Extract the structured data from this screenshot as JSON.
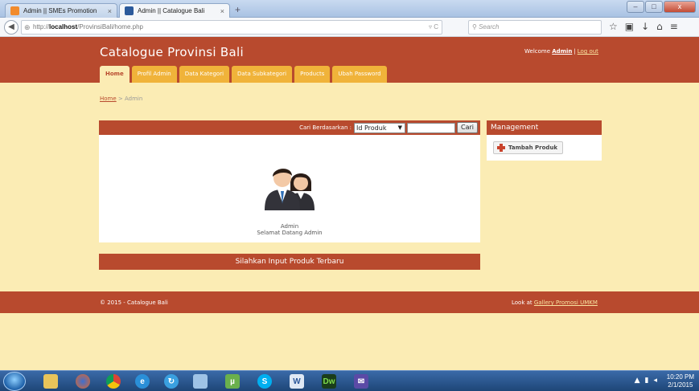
{
  "browser": {
    "tabs": [
      {
        "label": "Admin || SMEs Promotion",
        "active": false
      },
      {
        "label": "Admin || Catalogue Bali",
        "active": true
      }
    ],
    "new_tab": "+",
    "url_prefix": "http://",
    "url_host": "localhost",
    "url_path": "/ProvinsiBali/home.php",
    "search_placeholder": "Search",
    "window_buttons": [
      "–",
      "□",
      "x"
    ]
  },
  "site": {
    "title": "Catalogue Provinsi Bali",
    "welcome_prefix": "Welcome",
    "user": "Admin",
    "separator": "|",
    "logout": "Log out",
    "nav": [
      "Home",
      "Profil Admin",
      "Data Kategori",
      "Data Subkategori",
      "Products",
      "Ubah Password"
    ],
    "active_nav": "Home",
    "breadcrumb": {
      "home": "Home",
      "sep": " > ",
      "current": "Admin"
    },
    "search": {
      "label": "Cari Berdasarkan :",
      "selected": "Id Produk",
      "value": "",
      "button": "Cari"
    },
    "profile": {
      "name": "Admin",
      "greeting": "Selamat Datang Admin"
    },
    "input_banner": "Silahkan Input Produk Terbaru",
    "sidebar": {
      "title": "Management",
      "add_button": "Tambah Produk"
    },
    "footer": {
      "copyright": "© 2015 - Catalogue Bali",
      "look_prefix": "Look at",
      "look_link": "Gallery Promosi UMKM"
    },
    "colors": {
      "primary": "#b84a2e",
      "tab": "#f0b33a",
      "background": "#fbecb4"
    }
  },
  "taskbar": {
    "apps": [
      "explorer-icon",
      "firefox-icon",
      "chrome-icon",
      "edge-icon",
      "refresh-icon",
      "app-icon",
      "utorrent-icon",
      "skype-icon",
      "word-icon",
      "dreamweaver-icon",
      "mail-icon"
    ],
    "dreamweaver_label": "Dw",
    "skype_label": "S",
    "clock_time": "10:20 PM",
    "clock_date": "2/1/2015"
  }
}
